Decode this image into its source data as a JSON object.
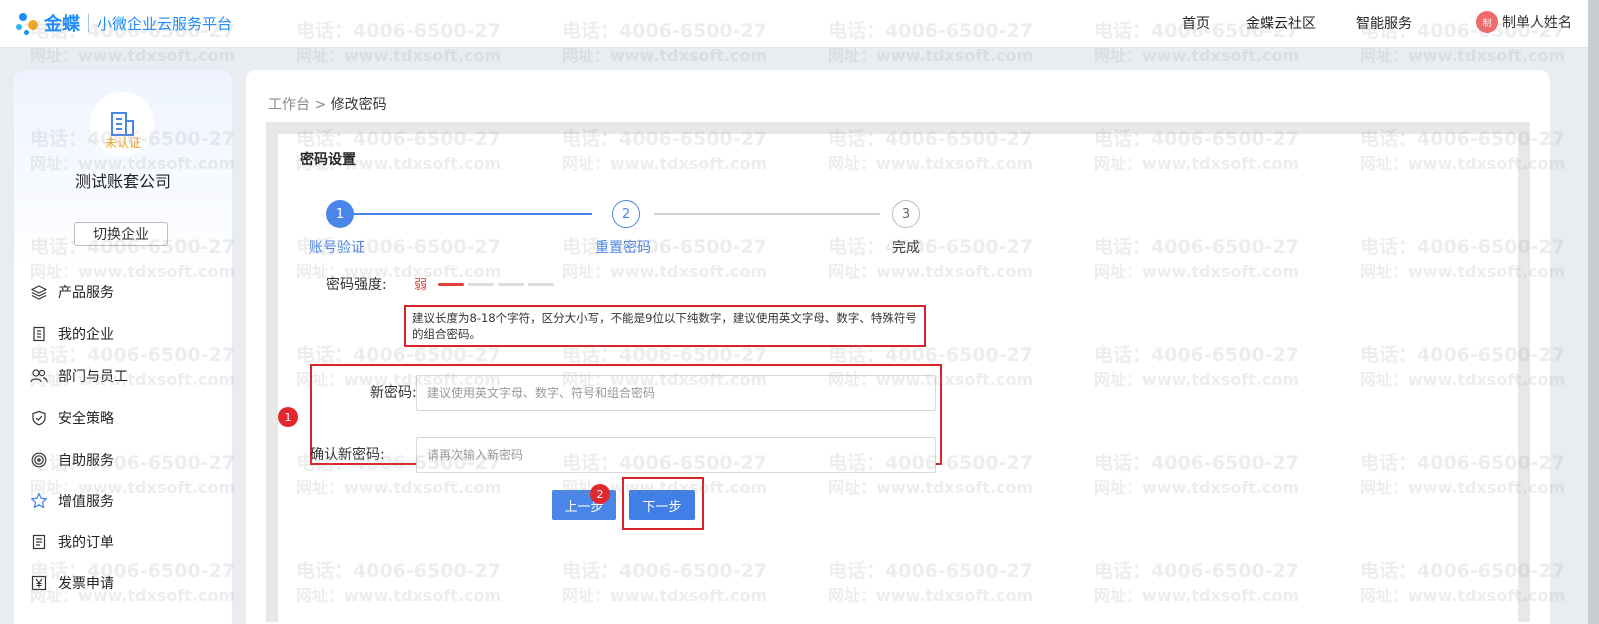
{
  "header": {
    "brand": "金蝶",
    "platform_name": "小微企业云服务平台",
    "nav": [
      "首页",
      "金蝶云社区",
      "智能服务"
    ],
    "user_avatar_text": "制",
    "user_name": "制单人姓名"
  },
  "sidebar": {
    "company_status": "未认证",
    "company_name": "测试账套公司",
    "switch_label": "切换企业",
    "items": [
      {
        "label": "产品服务",
        "icon": "layers-icon"
      },
      {
        "label": "我的企业",
        "icon": "building-icon"
      },
      {
        "label": "部门与员工",
        "icon": "people-icon"
      },
      {
        "label": "安全策略",
        "icon": "shield-icon"
      },
      {
        "label": "自助服务",
        "icon": "target-icon"
      },
      {
        "label": "增值服务",
        "icon": "star-icon"
      },
      {
        "label": "我的订单",
        "icon": "list-icon"
      },
      {
        "label": "发票申请",
        "icon": "yen-icon"
      }
    ]
  },
  "breadcrumb": {
    "root": "工作台",
    "separator": ">",
    "current": "修改密码"
  },
  "form": {
    "title": "密码设置",
    "steps": [
      {
        "num": "1",
        "label": "账号验证",
        "state": "done"
      },
      {
        "num": "2",
        "label": "重置密码",
        "state": "active"
      },
      {
        "num": "3",
        "label": "完成",
        "state": "todo"
      }
    ],
    "strength_label": "密码强度:",
    "strength_value": "弱",
    "strength_level": 1,
    "strength_total": 4,
    "hint": "建议长度为8-18个字符，区分大小写，不能是9位以下纯数字，建议使用英文字母、数字、特殊符号的组合密码。",
    "new_password_label": "新密码:",
    "new_password_placeholder": "建议使用英文字母、数字、符号和组合密码",
    "confirm_password_label": "确认新密码:",
    "confirm_password_placeholder": "请再次输入新密码",
    "prev_label": "上一步",
    "next_label": "下一步",
    "badges": [
      "1",
      "2"
    ]
  },
  "watermark": {
    "line1": "电话：4006-6500-27",
    "line2": "网址：www.tdxsoft.com"
  },
  "colors": {
    "primary": "#3f7fe6",
    "brand": "#1a8cff",
    "annotation": "#d8232a",
    "weak": "#e0423b",
    "warning": "#f5a623"
  }
}
